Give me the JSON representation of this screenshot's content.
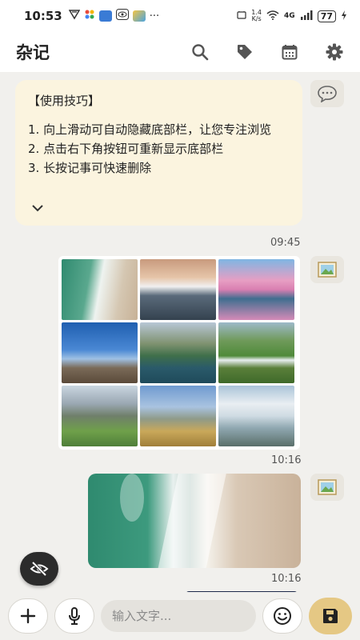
{
  "status_bar": {
    "time": "10:53",
    "more": "···",
    "net_speed_top": "1.4",
    "net_speed_bottom": "K/s",
    "network_type": "4G",
    "battery": "77"
  },
  "header": {
    "title": "杂记",
    "actions": [
      "search-icon",
      "tag-icon",
      "calendar-icon",
      "gear-icon"
    ]
  },
  "notes": {
    "tip": {
      "title": "【使用技巧】",
      "lines": [
        "1. 向上滑动可自动隐藏底部栏，让您专注浏览",
        "2. 点击右下角按钮可重新显示底部栏",
        "3. 长按记事可快速删除"
      ],
      "time": "09:45"
    },
    "gallery": {
      "time": "10:16",
      "thumbs": [
        "beach",
        "mountain",
        "lake-blossom",
        "rock-sky",
        "island-church",
        "waterfall-green",
        "alps-village",
        "cliff-coast",
        "large-waterfall"
      ]
    },
    "photo": {
      "time": "10:16"
    }
  },
  "bottom_bar": {
    "input_placeholder": "输入文字..."
  },
  "colors": {
    "background": "#f1f0ed",
    "tip_card": "#fbf4df",
    "save_button": "#e5c884"
  }
}
